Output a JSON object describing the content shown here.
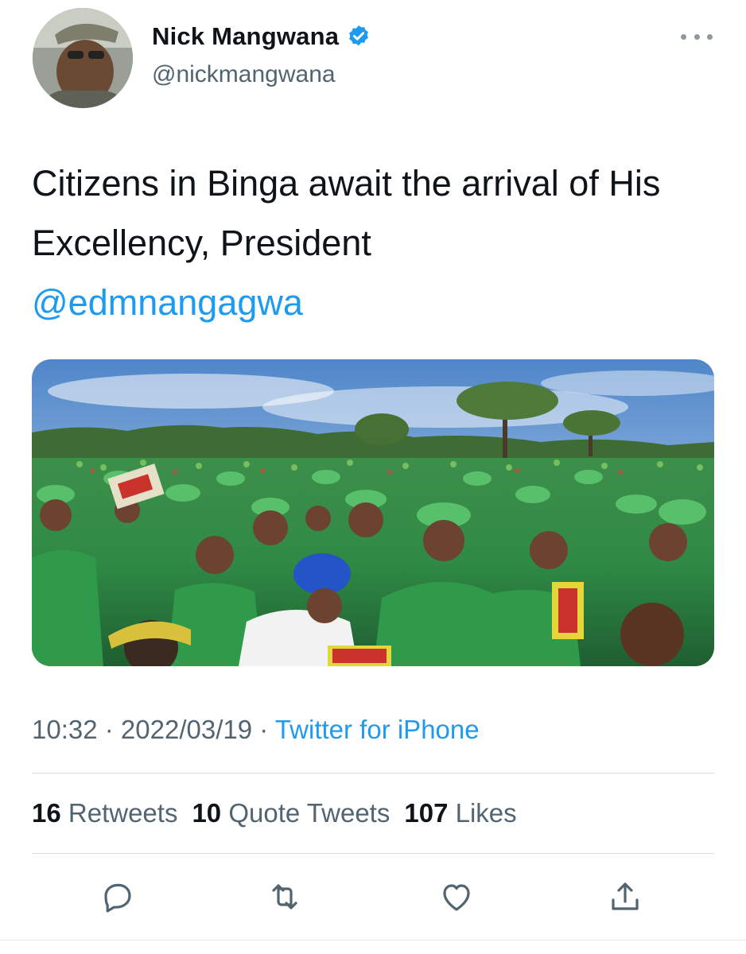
{
  "author": {
    "name": "Nick Mangwana",
    "handle": "@nickmangwana",
    "verified": true,
    "avatar_icon": "profile-photo"
  },
  "tweet": {
    "text": "Citizens in Binga await the arrival of His Excellency, President",
    "mention": "@edmnangagwa",
    "media_description_icon": "crowd-photo"
  },
  "meta": {
    "time": "10:32",
    "separator": " · ",
    "date": "2022/03/19",
    "source": "Twitter for iPhone"
  },
  "stats": {
    "retweets_count": "16",
    "retweets_label": "Retweets",
    "quotes_count": "10",
    "quotes_label": "Quote Tweets",
    "likes_count": "107",
    "likes_label": "Likes"
  },
  "actions": [
    "reply-icon",
    "retweet-icon",
    "like-icon",
    "share-icon"
  ],
  "colors": {
    "accent": "#1d9bf0",
    "text": "#0f1419",
    "secondary": "#536471",
    "divider": "#d9dee2"
  }
}
